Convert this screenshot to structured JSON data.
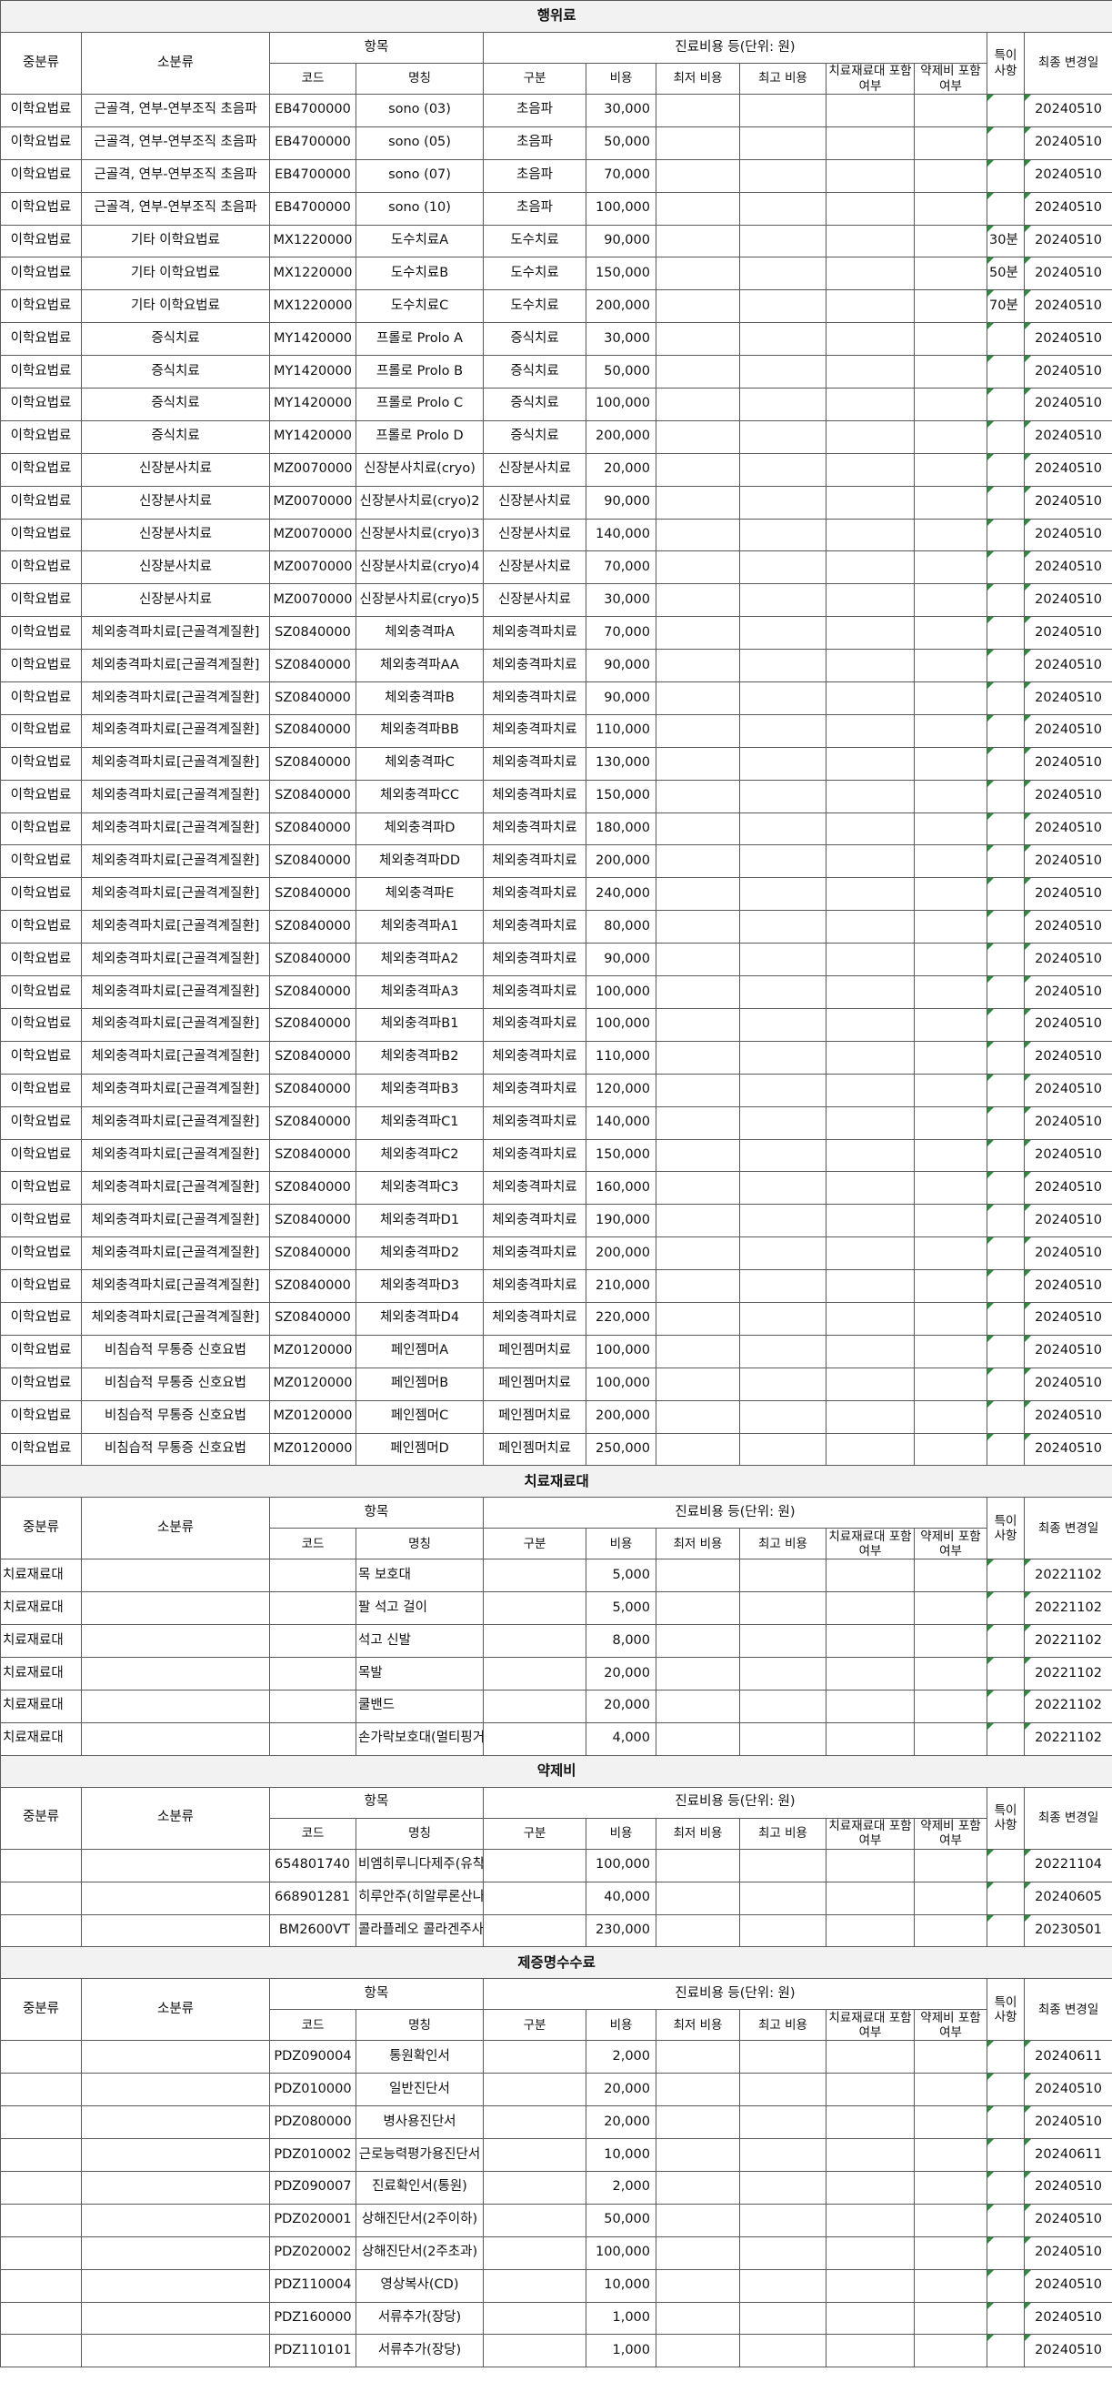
{
  "headers": {
    "category": "중분류",
    "subcategory": "소분류",
    "item": "항목",
    "code": "코드",
    "name": "명칭",
    "cost_group": "진료비용 등(단위: 원)",
    "type": "구분",
    "cost": "비용",
    "min_cost": "최저 비용",
    "max_cost": "최고 비용",
    "material_included": "치료재료대 포함여부",
    "drug_included": "약제비 포함여부",
    "note": "특이 사항",
    "last_changed": "최종 변경일"
  },
  "sections": [
    {
      "title": "행위료",
      "rows": [
        [
          "이학요법료",
          "근골격, 연부-연부조직 초음파",
          "EB4700000",
          "sono (03)",
          "초음파",
          "30,000",
          "20240510",
          ""
        ],
        [
          "이학요법료",
          "근골격, 연부-연부조직 초음파",
          "EB4700000",
          "sono (05)",
          "초음파",
          "50,000",
          "20240510",
          ""
        ],
        [
          "이학요법료",
          "근골격, 연부-연부조직 초음파",
          "EB4700000",
          "sono (07)",
          "초음파",
          "70,000",
          "20240510",
          ""
        ],
        [
          "이학요법료",
          "근골격, 연부-연부조직 초음파",
          "EB4700000",
          "sono (10)",
          "초음파",
          "100,000",
          "20240510",
          ""
        ],
        [
          "이학요법료",
          "기타 이학요법료",
          "MX1220000",
          "도수치료A",
          "도수치료",
          "90,000",
          "20240510",
          "30분"
        ],
        [
          "이학요법료",
          "기타 이학요법료",
          "MX1220000",
          "도수치료B",
          "도수치료",
          "150,000",
          "20240510",
          "50분"
        ],
        [
          "이학요법료",
          "기타 이학요법료",
          "MX1220000",
          "도수치료C",
          "도수치료",
          "200,000",
          "20240510",
          "70분"
        ],
        [
          "이학요법료",
          "증식치료",
          "MY1420000",
          "프롤로 Prolo A",
          "증식치료",
          "30,000",
          "20240510",
          ""
        ],
        [
          "이학요법료",
          "증식치료",
          "MY1420000",
          "프롤로 Prolo B",
          "증식치료",
          "50,000",
          "20240510",
          ""
        ],
        [
          "이학요법료",
          "증식치료",
          "MY1420000",
          "프롤로 Prolo C",
          "증식치료",
          "100,000",
          "20240510",
          ""
        ],
        [
          "이학요법료",
          "증식치료",
          "MY1420000",
          "프롤로 Prolo D",
          "증식치료",
          "200,000",
          "20240510",
          ""
        ],
        [
          "이학요법료",
          "신장분사치료",
          "MZ0070000",
          "신장분사치료(cryo)",
          "신장분사치료",
          "20,000",
          "20240510",
          ""
        ],
        [
          "이학요법료",
          "신장분사치료",
          "MZ0070000",
          "신장분사치료(cryo)2",
          "신장분사치료",
          "90,000",
          "20240510",
          ""
        ],
        [
          "이학요법료",
          "신장분사치료",
          "MZ0070000",
          "신장분사치료(cryo)3",
          "신장분사치료",
          "140,000",
          "20240510",
          ""
        ],
        [
          "이학요법료",
          "신장분사치료",
          "MZ0070000",
          "신장분사치료(cryo)4",
          "신장분사치료",
          "70,000",
          "20240510",
          ""
        ],
        [
          "이학요법료",
          "신장분사치료",
          "MZ0070000",
          "신장분사치료(cryo)5",
          "신장분사치료",
          "30,000",
          "20240510",
          ""
        ],
        [
          "이학요법료",
          "체외충격파치료[근골격계질환]",
          "SZ0840000",
          "체외충격파A",
          "체외충격파치료",
          "70,000",
          "20240510",
          ""
        ],
        [
          "이학요법료",
          "체외충격파치료[근골격계질환]",
          "SZ0840000",
          "체외충격파AA",
          "체외충격파치료",
          "90,000",
          "20240510",
          ""
        ],
        [
          "이학요법료",
          "체외충격파치료[근골격계질환]",
          "SZ0840000",
          "체외충격파B",
          "체외충격파치료",
          "90,000",
          "20240510",
          ""
        ],
        [
          "이학요법료",
          "체외충격파치료[근골격계질환]",
          "SZ0840000",
          "체외충격파BB",
          "체외충격파치료",
          "110,000",
          "20240510",
          ""
        ],
        [
          "이학요법료",
          "체외충격파치료[근골격계질환]",
          "SZ0840000",
          "체외충격파C",
          "체외충격파치료",
          "130,000",
          "20240510",
          ""
        ],
        [
          "이학요법료",
          "체외충격파치료[근골격계질환]",
          "SZ0840000",
          "체외충격파CC",
          "체외충격파치료",
          "150,000",
          "20240510",
          ""
        ],
        [
          "이학요법료",
          "체외충격파치료[근골격계질환]",
          "SZ0840000",
          "체외충격파D",
          "체외충격파치료",
          "180,000",
          "20240510",
          ""
        ],
        [
          "이학요법료",
          "체외충격파치료[근골격계질환]",
          "SZ0840000",
          "체외충격파DD",
          "체외충격파치료",
          "200,000",
          "20240510",
          ""
        ],
        [
          "이학요법료",
          "체외충격파치료[근골격계질환]",
          "SZ0840000",
          "체외충격파E",
          "체외충격파치료",
          "240,000",
          "20240510",
          ""
        ],
        [
          "이학요법료",
          "체외충격파치료[근골격계질환]",
          "SZ0840000",
          "체외충격파A1",
          "체외충격파치료",
          "80,000",
          "20240510",
          ""
        ],
        [
          "이학요법료",
          "체외충격파치료[근골격계질환]",
          "SZ0840000",
          "체외충격파A2",
          "체외충격파치료",
          "90,000",
          "20240510",
          ""
        ],
        [
          "이학요법료",
          "체외충격파치료[근골격계질환]",
          "SZ0840000",
          "체외충격파A3",
          "체외충격파치료",
          "100,000",
          "20240510",
          ""
        ],
        [
          "이학요법료",
          "체외충격파치료[근골격계질환]",
          "SZ0840000",
          "체외충격파B1",
          "체외충격파치료",
          "100,000",
          "20240510",
          ""
        ],
        [
          "이학요법료",
          "체외충격파치료[근골격계질환]",
          "SZ0840000",
          "체외충격파B2",
          "체외충격파치료",
          "110,000",
          "20240510",
          ""
        ],
        [
          "이학요법료",
          "체외충격파치료[근골격계질환]",
          "SZ0840000",
          "체외충격파B3",
          "체외충격파치료",
          "120,000",
          "20240510",
          ""
        ],
        [
          "이학요법료",
          "체외충격파치료[근골격계질환]",
          "SZ0840000",
          "체외충격파C1",
          "체외충격파치료",
          "140,000",
          "20240510",
          ""
        ],
        [
          "이학요법료",
          "체외충격파치료[근골격계질환]",
          "SZ0840000",
          "체외충격파C2",
          "체외충격파치료",
          "150,000",
          "20240510",
          ""
        ],
        [
          "이학요법료",
          "체외충격파치료[근골격계질환]",
          "SZ0840000",
          "체외충격파C3",
          "체외충격파치료",
          "160,000",
          "20240510",
          ""
        ],
        [
          "이학요법료",
          "체외충격파치료[근골격계질환]",
          "SZ0840000",
          "체외충격파D1",
          "체외충격파치료",
          "190,000",
          "20240510",
          ""
        ],
        [
          "이학요법료",
          "체외충격파치료[근골격계질환]",
          "SZ0840000",
          "체외충격파D2",
          "체외충격파치료",
          "200,000",
          "20240510",
          ""
        ],
        [
          "이학요법료",
          "체외충격파치료[근골격계질환]",
          "SZ0840000",
          "체외충격파D3",
          "체외충격파치료",
          "210,000",
          "20240510",
          ""
        ],
        [
          "이학요법료",
          "체외충격파치료[근골격계질환]",
          "SZ0840000",
          "체외충격파D4",
          "체외충격파치료",
          "220,000",
          "20240510",
          ""
        ],
        [
          "이학요법료",
          "비침습적 무통증 신호요법",
          "MZ0120000",
          "페인젬머A",
          "페인젬머치료",
          "100,000",
          "20240510",
          ""
        ],
        [
          "이학요법료",
          "비침습적 무통증 신호요법",
          "MZ0120000",
          "페인젬머B",
          "페인젬머치료",
          "100,000",
          "20240510",
          ""
        ],
        [
          "이학요법료",
          "비침습적 무통증 신호요법",
          "MZ0120000",
          "페인젬머C",
          "페인젬머치료",
          "200,000",
          "20240510",
          ""
        ],
        [
          "이학요법료",
          "비침습적 무통증 신호요법",
          "MZ0120000",
          "페인젬머D",
          "페인젬머치료",
          "250,000",
          "20240510",
          ""
        ]
      ]
    },
    {
      "title": "치료재료대",
      "rows": [
        [
          "치료재료대",
          "",
          "",
          "목 보호대",
          "",
          "5,000",
          "20221102",
          ""
        ],
        [
          "치료재료대",
          "",
          "",
          "팔 석고 걸이",
          "",
          "5,000",
          "20221102",
          ""
        ],
        [
          "치료재료대",
          "",
          "",
          "석고 신발",
          "",
          "8,000",
          "20221102",
          ""
        ],
        [
          "치료재료대",
          "",
          "",
          "목발",
          "",
          "20,000",
          "20221102",
          ""
        ],
        [
          "치료재료대",
          "",
          "",
          "쿨밴드",
          "",
          "20,000",
          "20221102",
          ""
        ],
        [
          "치료재료대",
          "",
          "",
          "손가락보호대(멀티핑거)",
          "",
          "4,000",
          "20221102",
          ""
        ]
      ]
    },
    {
      "title": "약제비",
      "rows": [
        [
          "",
          "",
          "654801740",
          "비엠히루니다제주(유착방지제)",
          "",
          "100,000",
          "20221104",
          ""
        ],
        [
          "",
          "",
          "668901281",
          "히루안주(히알루론산나트륨 연골주사",
          "",
          "40,000",
          "20240605",
          ""
        ],
        [
          "",
          "",
          "BM2600VT",
          "콜라플레오 콜라겐주사",
          "",
          "230,000",
          "20230501",
          ""
        ]
      ]
    },
    {
      "title": "제증명수수료",
      "rows": [
        [
          "",
          "",
          "PDZ090004",
          "통원확인서",
          "",
          "2,000",
          "20240611",
          ""
        ],
        [
          "",
          "",
          "PDZ010000",
          "일반진단서",
          "",
          "20,000",
          "20240510",
          ""
        ],
        [
          "",
          "",
          "PDZ080000",
          "병사용진단서",
          "",
          "20,000",
          "20240510",
          ""
        ],
        [
          "",
          "",
          "PDZ010002",
          "근로능력평가용진단서",
          "",
          "10,000",
          "20240611",
          ""
        ],
        [
          "",
          "",
          "PDZ090007",
          "진료확인서(통원)",
          "",
          "2,000",
          "20240510",
          ""
        ],
        [
          "",
          "",
          "PDZ020001",
          "상해진단서(2주이하)",
          "",
          "50,000",
          "20240510",
          ""
        ],
        [
          "",
          "",
          "PDZ020002",
          "상해진단서(2주초과)",
          "",
          "100,000",
          "20240510",
          ""
        ],
        [
          "",
          "",
          "PDZ110004",
          "영상복사(CD)",
          "",
          "10,000",
          "20240510",
          ""
        ],
        [
          "",
          "",
          "PDZ160000",
          "서류추가(장당)",
          "",
          "1,000",
          "20240510",
          ""
        ],
        [
          "",
          "",
          "PDZ110101",
          "서류추가(장당)",
          "",
          "1,000",
          "20240510",
          ""
        ]
      ]
    }
  ]
}
